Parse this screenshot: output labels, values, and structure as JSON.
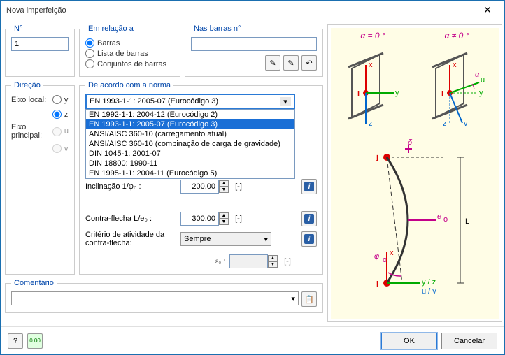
{
  "title": "Nova imperfeição",
  "groups": {
    "n": {
      "legend": "N°",
      "value": "1"
    },
    "rel": {
      "legend": "Em relação a",
      "opts": [
        "Barras",
        "Lista de barras",
        "Conjuntos de barras"
      ],
      "selected": 0
    },
    "bars": {
      "legend": "Nas barras n°"
    },
    "dir": {
      "legend": "Direção",
      "eixo_local": "Eixo local:",
      "eixo_principal": "Eixo principal:",
      "y": "y",
      "z": "z",
      "u": "u",
      "v": "v",
      "sel": "z"
    },
    "norma": {
      "legend": "De acordo com a norma",
      "selected": "EN 1993-1-1: 2005-07  (Eurocódigo 3)",
      "items": [
        "EN 1992-1-1: 2004-12  (Eurocódigo 2)",
        "EN 1993-1-1: 2005-07  (Eurocódigo 3)",
        "ANSI/AISC 360-10 (carregamento atual)",
        "ANSI/AISC 360-10 (combinação de carga de gravidade)",
        "DIN 1045-1: 2001-07",
        "DIN 18800: 1990-11",
        "EN 1995-1-1: 2004-11  (Eurocódigo 5)"
      ],
      "hl": 1,
      "incl_label": "Inclinação 1/φ₀ :",
      "incl_val": "200.00",
      "contra_label": "Contra-flecha L/e₀ :",
      "contra_val": "300.00",
      "crit_label": "Critério de atividade da contra-flecha:",
      "crit_val": "Sempre",
      "eps_label": "ε₀ :",
      "unit_dash": "[-]"
    },
    "comentario": {
      "legend": "Comentário"
    }
  },
  "alpha_eq": "α = 0 °",
  "alpha_neq": "α ≠ 0 °",
  "footer": {
    "ok": "OK",
    "cancel": "Cancelar"
  }
}
